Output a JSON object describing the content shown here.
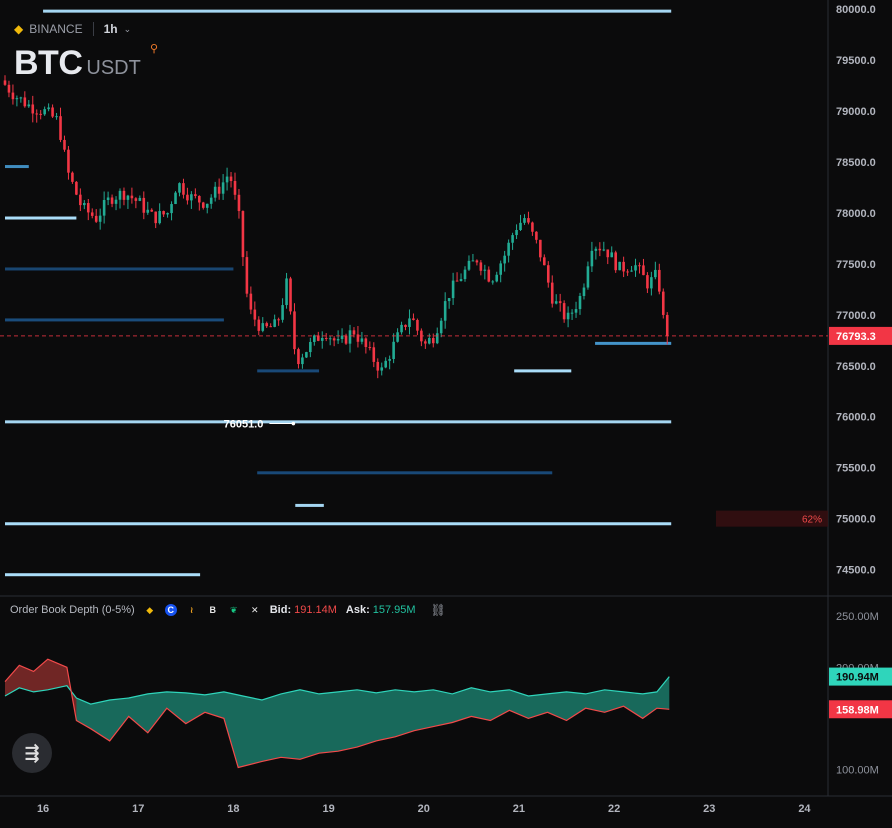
{
  "header": {
    "exchange": "BINANCE",
    "interval": "1h",
    "base": "BTC",
    "quote": "USDT"
  },
  "indicator": {
    "name": "Order Book Depth (0-5%)",
    "bid_label": "Bid:",
    "bid_value": "191.14M",
    "ask_label": "Ask:",
    "ask_value": "157.95M",
    "exchange_icons": [
      "binance-icon",
      "coinbase-icon",
      "bitfinex-icon",
      "bybit-icon",
      "leaf-icon",
      "okx-icon"
    ]
  },
  "colors": {
    "up": "#22ab94",
    "down": "#f23645",
    "heat": "#aee2ff",
    "depth_ask": "#2fd5bb",
    "depth_bid": "#f24a4a",
    "background": "#0b0b0c"
  },
  "chart_data": {
    "type": "candlestick",
    "x_ticks": [
      "16",
      "17",
      "18",
      "19",
      "20",
      "21",
      "22",
      "23",
      "24"
    ],
    "y_ticks": [
      "80000.0",
      "79500.0",
      "79000.0",
      "78500.0",
      "78000.0",
      "77500.0",
      "77000.0",
      "76500.0",
      "76000.0",
      "75500.0",
      "75000.0",
      "74500.0"
    ],
    "ylim": [
      74300,
      80050
    ],
    "xlim": [
      15.6,
      24.3
    ],
    "last_price": "76793.3",
    "annotation_low": "76051.0",
    "bid_ask_imbalance": "62%",
    "price_path": [
      [
        15.6,
        79300
      ],
      [
        15.75,
        79150
      ],
      [
        15.9,
        79050
      ],
      [
        16.05,
        79000
      ],
      [
        16.2,
        78900
      ],
      [
        16.3,
        78400
      ],
      [
        16.45,
        78050
      ],
      [
        16.6,
        77950
      ],
      [
        16.75,
        78150
      ],
      [
        16.9,
        78200
      ],
      [
        17.05,
        78100
      ],
      [
        17.2,
        77950
      ],
      [
        17.35,
        78000
      ],
      [
        17.45,
        78300
      ],
      [
        17.6,
        78150
      ],
      [
        17.75,
        78100
      ],
      [
        17.9,
        78250
      ],
      [
        18.0,
        78400
      ],
      [
        18.1,
        77950
      ],
      [
        18.2,
        77050
      ],
      [
        18.35,
        76850
      ],
      [
        18.5,
        76900
      ],
      [
        18.6,
        77300
      ],
      [
        18.7,
        76550
      ],
      [
        18.85,
        76700
      ],
      [
        19.0,
        76850
      ],
      [
        19.15,
        76700
      ],
      [
        19.3,
        76850
      ],
      [
        19.45,
        76650
      ],
      [
        19.6,
        76450
      ],
      [
        19.75,
        76750
      ],
      [
        19.9,
        77000
      ],
      [
        20.05,
        76700
      ],
      [
        20.15,
        76800
      ],
      [
        20.3,
        77200
      ],
      [
        20.45,
        77400
      ],
      [
        20.6,
        77550
      ],
      [
        20.75,
        77350
      ],
      [
        20.9,
        77600
      ],
      [
        21.0,
        77850
      ],
      [
        21.1,
        77950
      ],
      [
        21.25,
        77650
      ],
      [
        21.4,
        77150
      ],
      [
        21.55,
        76950
      ],
      [
        21.7,
        77200
      ],
      [
        21.8,
        77700
      ],
      [
        21.95,
        77650
      ],
      [
        22.1,
        77450
      ],
      [
        22.25,
        77500
      ],
      [
        22.4,
        77300
      ],
      [
        22.5,
        77400
      ],
      [
        22.58,
        76793
      ]
    ],
    "heatmap_levels": [
      {
        "price": 79980,
        "from": 16.0,
        "to": 22.6,
        "strength": 0.9
      },
      {
        "price": 78455,
        "from": 15.6,
        "to": 15.85,
        "strength": 0.7
      },
      {
        "price": 77950,
        "from": 15.6,
        "to": 16.35,
        "strength": 0.95
      },
      {
        "price": 77450,
        "from": 15.6,
        "to": 18.0,
        "strength": 0.4
      },
      {
        "price": 76950,
        "from": 15.6,
        "to": 17.9,
        "strength": 0.55
      },
      {
        "price": 76720,
        "from": 21.8,
        "to": 22.6,
        "strength": 0.8
      },
      {
        "price": 76450,
        "from": 18.25,
        "to": 18.9,
        "strength": 0.5
      },
      {
        "price": 76450,
        "from": 20.95,
        "to": 21.55,
        "strength": 0.95
      },
      {
        "price": 75950,
        "from": 15.6,
        "to": 22.6,
        "strength": 0.9
      },
      {
        "price": 75450,
        "from": 18.25,
        "to": 21.35,
        "strength": 0.5
      },
      {
        "price": 75130,
        "from": 18.65,
        "to": 18.95,
        "strength": 0.9
      },
      {
        "price": 74950,
        "from": 15.6,
        "to": 22.6,
        "strength": 0.95
      },
      {
        "price": 74450,
        "from": 15.6,
        "to": 17.65,
        "strength": 0.95
      }
    ],
    "depth_y_ticks": [
      "250.00M",
      "200.00M",
      "100.00M"
    ],
    "depth_ylim": [
      80,
      260
    ],
    "depth_bid_label": "190.94M",
    "depth_ask_label": "158.98M",
    "depth_ask": [
      [
        15.6,
        172
      ],
      [
        15.75,
        180
      ],
      [
        15.9,
        176
      ],
      [
        16.05,
        178
      ],
      [
        16.25,
        182
      ],
      [
        16.35,
        170
      ],
      [
        16.5,
        164
      ],
      [
        16.7,
        168
      ],
      [
        16.9,
        170
      ],
      [
        17.1,
        174
      ],
      [
        17.3,
        176
      ],
      [
        17.5,
        175
      ],
      [
        17.7,
        173
      ],
      [
        17.9,
        176
      ],
      [
        18.1,
        172
      ],
      [
        18.3,
        168
      ],
      [
        18.5,
        174
      ],
      [
        18.7,
        178
      ],
      [
        18.9,
        174
      ],
      [
        19.1,
        176
      ],
      [
        19.3,
        178
      ],
      [
        19.5,
        175
      ],
      [
        19.7,
        178
      ],
      [
        19.9,
        176
      ],
      [
        20.1,
        178
      ],
      [
        20.3,
        174
      ],
      [
        20.5,
        180
      ],
      [
        20.7,
        176
      ],
      [
        20.9,
        178
      ],
      [
        21.1,
        172
      ],
      [
        21.3,
        174
      ],
      [
        21.5,
        176
      ],
      [
        21.7,
        174
      ],
      [
        21.9,
        178
      ],
      [
        22.1,
        176
      ],
      [
        22.3,
        174
      ],
      [
        22.45,
        176
      ],
      [
        22.58,
        190.94
      ]
    ],
    "depth_bid": [
      [
        15.6,
        186
      ],
      [
        15.75,
        202
      ],
      [
        15.9,
        196
      ],
      [
        16.05,
        208
      ],
      [
        16.25,
        200
      ],
      [
        16.35,
        148
      ],
      [
        16.5,
        140
      ],
      [
        16.7,
        128
      ],
      [
        16.9,
        152
      ],
      [
        17.1,
        136
      ],
      [
        17.3,
        160
      ],
      [
        17.5,
        145
      ],
      [
        17.7,
        156
      ],
      [
        17.9,
        150
      ],
      [
        18.05,
        102
      ],
      [
        18.3,
        108
      ],
      [
        18.5,
        112
      ],
      [
        18.7,
        110
      ],
      [
        18.9,
        116
      ],
      [
        19.1,
        118
      ],
      [
        19.3,
        122
      ],
      [
        19.5,
        128
      ],
      [
        19.7,
        132
      ],
      [
        19.9,
        138
      ],
      [
        20.1,
        142
      ],
      [
        20.3,
        146
      ],
      [
        20.5,
        152
      ],
      [
        20.7,
        148
      ],
      [
        20.9,
        158
      ],
      [
        21.1,
        150
      ],
      [
        21.3,
        156
      ],
      [
        21.5,
        148
      ],
      [
        21.7,
        160
      ],
      [
        21.9,
        156
      ],
      [
        22.1,
        162
      ],
      [
        22.3,
        150
      ],
      [
        22.45,
        160
      ],
      [
        22.58,
        158.98
      ]
    ]
  }
}
